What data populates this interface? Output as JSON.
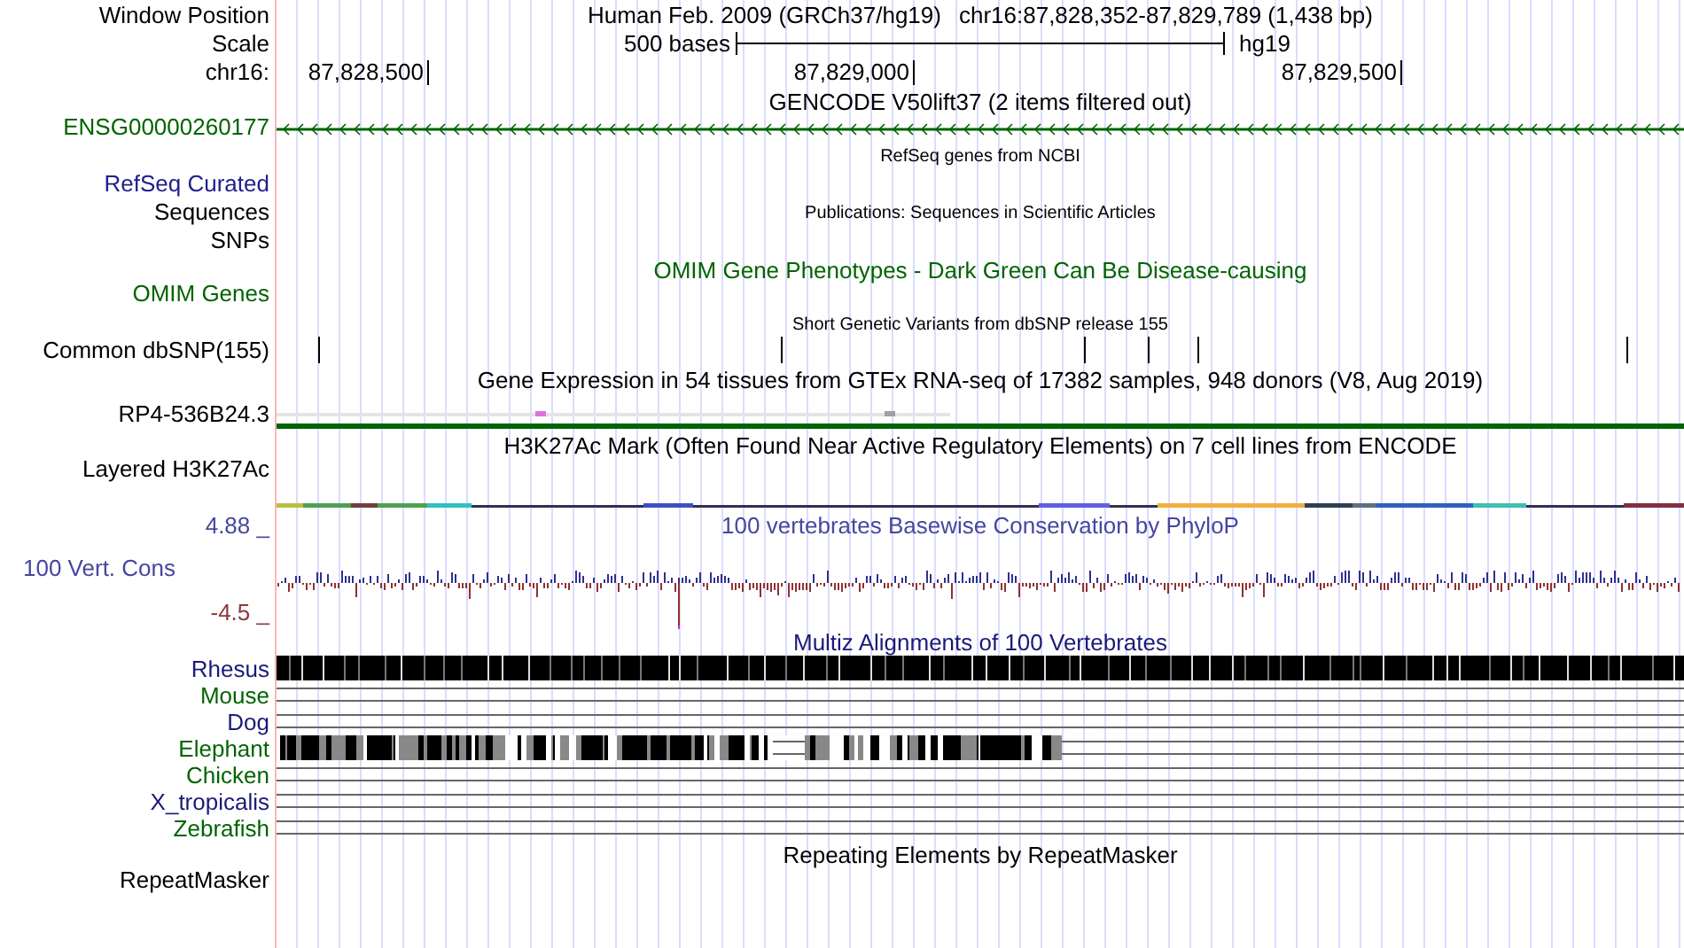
{
  "header": {
    "label": "Window Position",
    "title": "Human Feb. 2009 (GRCh37/hg19)",
    "position": "chr16:87,828,352-87,829,789 (1,438 bp)"
  },
  "scale": {
    "label": "Scale",
    "bar_label": "500 bases",
    "assembly": "hg19"
  },
  "ruler": {
    "label": "chr16:",
    "ticks": [
      "87,828,500",
      "87,829,000",
      "87,829,500"
    ]
  },
  "tracks": [
    {
      "kind": "gene",
      "title": "GENCODE V50lift37 (2 items filtered out)",
      "label": [
        "ENSG00000260177"
      ],
      "color": "#006400"
    },
    {
      "kind": "plain",
      "title": "RefSeq genes from NCBI",
      "label": [
        "RefSeq Curated"
      ],
      "color": "#20208c"
    },
    {
      "kind": "plain",
      "title": "Publications: Sequences in Scientific Articles",
      "label": [
        "Sequences",
        "SNPs"
      ],
      "color": "#000000"
    },
    {
      "kind": "phenotype",
      "title": "OMIM Gene Phenotypes - Dark Green Can Be Disease-causing",
      "label": [
        "OMIM Genes"
      ],
      "color": "#006400"
    },
    {
      "kind": "snp",
      "title": "Short Genetic Variants from dbSNP release 155",
      "label": [
        "Common dbSNP(155)"
      ],
      "color": "#000000"
    },
    {
      "kind": "expression",
      "title": "Gene Expression in 54 tissues from GTEx RNA-seq of 17382 samples, 948 donors (V8, Aug 2019)",
      "label": [
        "RP4-536B24.3"
      ],
      "color": "#000000"
    },
    {
      "kind": "signal",
      "title": "H3K27Ac Mark (Often Found Near Active Regulatory Elements) on 7 cell lines from ENCODE",
      "label": [
        "Layered H3K27Ac"
      ],
      "color": "#000000"
    },
    {
      "kind": "conservation",
      "title": "100 vertebrates Basewise Conservation by PhyloP",
      "label": [
        "100 Vert. Cons"
      ],
      "color": "#4646a0",
      "ymax": "4.88 _",
      "ymin": "-4.5 _"
    },
    {
      "kind": "alignment",
      "title": "Multiz Alignments of 100 Vertebrates",
      "color": "#1a1a78",
      "species": [
        {
          "name": "Rhesus",
          "kind": "full",
          "color": "#1a1a78"
        },
        {
          "name": "Mouse",
          "kind": "none",
          "color": "#006400"
        },
        {
          "name": "Dog",
          "kind": "none",
          "color": "#1a1a78"
        },
        {
          "name": "Elephant",
          "kind": "partial",
          "color": "#006400"
        },
        {
          "name": "Chicken",
          "kind": "none",
          "color": "#006400"
        },
        {
          "name": "X_tropicalis",
          "kind": "none",
          "color": "#1a1a78"
        },
        {
          "name": "Zebrafish",
          "kind": "none",
          "color": "#006400"
        }
      ]
    },
    {
      "kind": "repeat",
      "title": "Repeating Elements by RepeatMasker",
      "label": [
        "RepeatMasker"
      ],
      "color": "#000000"
    }
  ]
}
